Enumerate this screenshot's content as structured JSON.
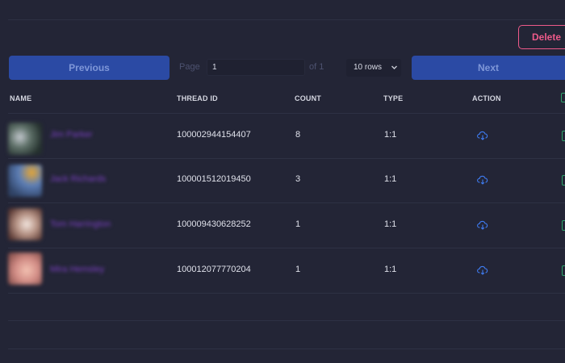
{
  "toolbar": {
    "delete_label": "Delete"
  },
  "pagination": {
    "previous_label": "Previous",
    "next_label": "Next",
    "page_label": "Page",
    "page_value": "1",
    "of_label": "of 1",
    "rows_label": "10 rows"
  },
  "table": {
    "columns": [
      "NAME",
      "THREAD ID",
      "COUNT",
      "TYPE",
      "ACTION"
    ],
    "rows": [
      {
        "name": "Jim Parker",
        "thread_id": "100002944154407",
        "count": "8",
        "type": "1:1"
      },
      {
        "name": "Jack Richards",
        "thread_id": "100001512019450",
        "count": "3",
        "type": "1:1"
      },
      {
        "name": "Tom Harrington",
        "thread_id": "100009430628252",
        "count": "1",
        "type": "1:1"
      },
      {
        "name": "Mira Hemsley",
        "thread_id": "100012077770204",
        "count": "1",
        "type": "1:1"
      }
    ]
  },
  "colors": {
    "background": "#232536",
    "accent_blue": "#2b4aa4",
    "delete_pink": "#ee5a8a",
    "checkbox_green": "#2fa36b",
    "name_purple": "#7a3fc0",
    "icon_blue": "#3f7cf2"
  },
  "icons": {
    "action": "cloud-download-icon",
    "rows_select": "chevron-down-icon"
  }
}
